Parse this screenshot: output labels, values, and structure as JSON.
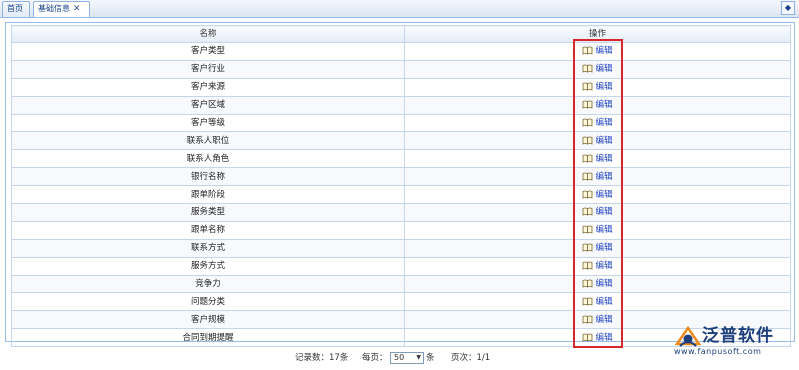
{
  "tabs": {
    "home_label": "首页",
    "active_label": "基础信息",
    "close_glyph": "✕"
  },
  "collapse_glyph": "◆",
  "columns": {
    "name": "名称",
    "operation": "操作"
  },
  "edit_label": "编辑",
  "rows": [
    "客户类型",
    "客户行业",
    "客户来源",
    "客户区域",
    "客户等级",
    "联系人职位",
    "联系人角色",
    "银行名称",
    "跟单阶段",
    "服务类型",
    "跟单名称",
    "联系方式",
    "服务方式",
    "竞争力",
    "问题分类",
    "客户规模",
    "合同到期提醒"
  ],
  "pager": {
    "records_label": "记录数：17条",
    "per_page_label": "每页：",
    "per_page_value": "50",
    "per_page_unit": "条",
    "page_label": "页次：1/1"
  },
  "logo": {
    "name": "泛普软件",
    "url": "www.fanpusoft.com"
  },
  "colors": {
    "highlight_box": "#d9262a",
    "edit_link": "#1a3fbf",
    "grid_border": "#c5d6ea"
  }
}
